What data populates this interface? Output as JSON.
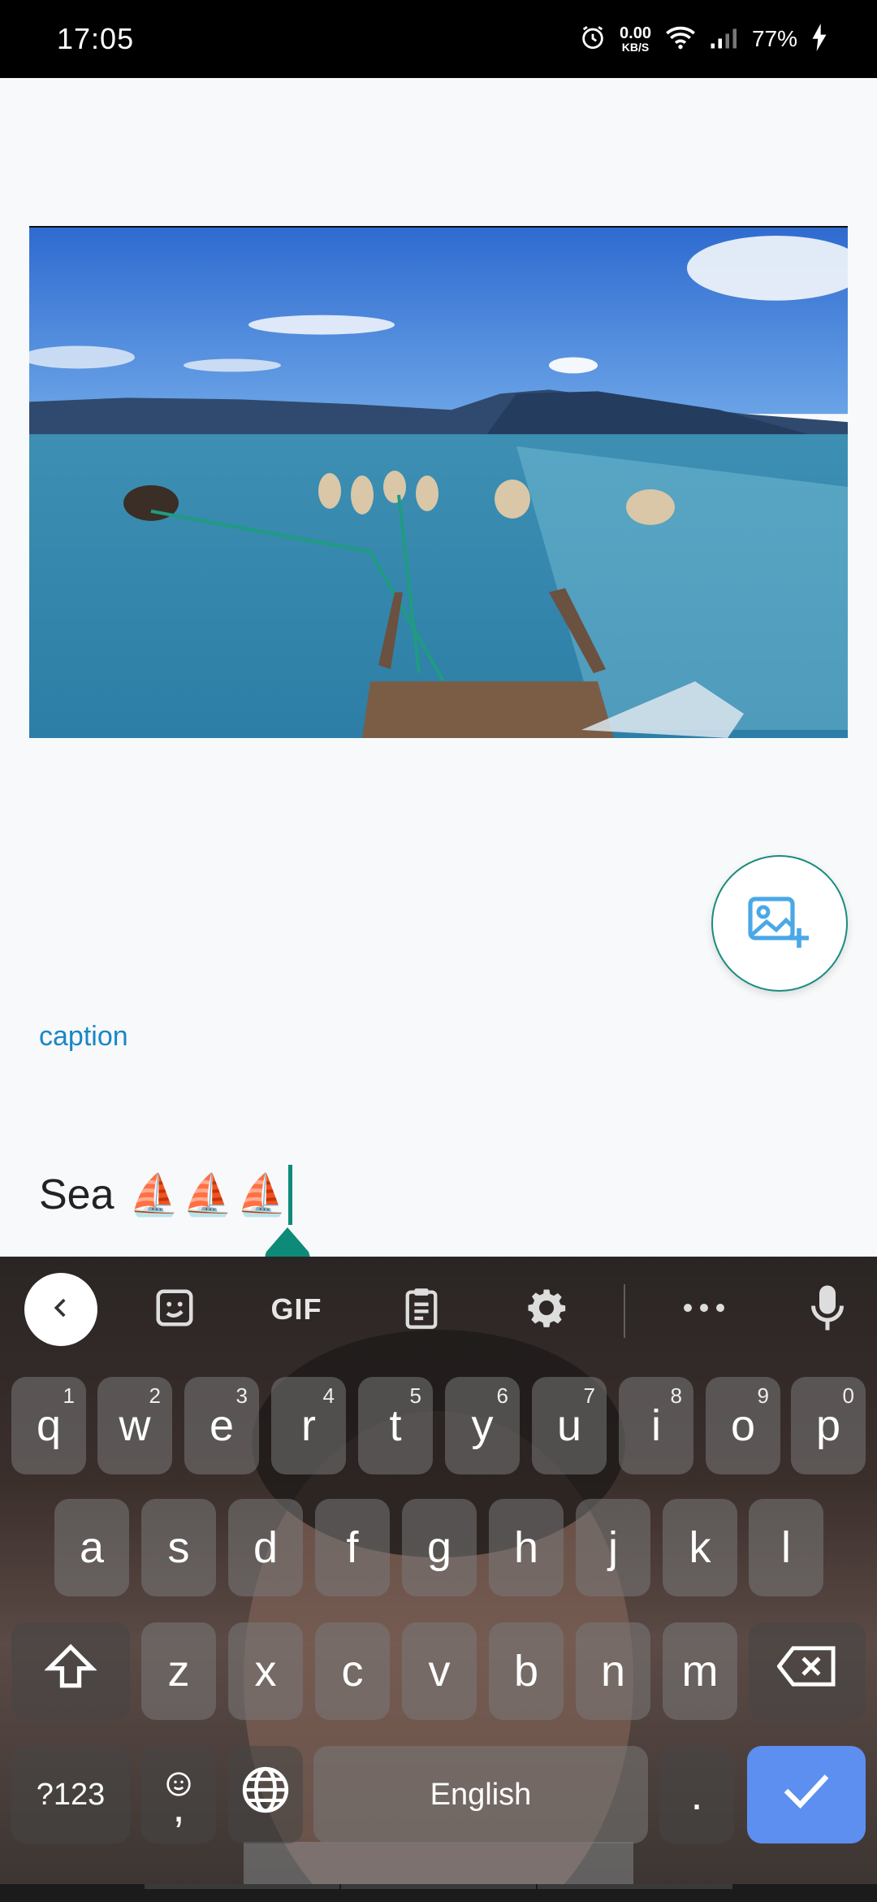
{
  "status_bar": {
    "time": "17:05",
    "net_speed_value": "0.00",
    "net_speed_unit": "KB/S",
    "battery": "77%"
  },
  "photo": {
    "description_icon": "photo-preview"
  },
  "add_photo": {
    "icon": "add-photo-icon",
    "accent": "#1b8c7e",
    "icon_color": "#4aa8e6"
  },
  "caption": {
    "label": "caption",
    "text": "Sea",
    "emojis": [
      "⛵",
      "⛵",
      "⛵"
    ]
  },
  "keyboard": {
    "toolbar": {
      "gif_label": "GIF",
      "icons": [
        "back-icon",
        "sticker-icon",
        "gif",
        "clipboard-icon",
        "gear-icon",
        "more-icon",
        "mic-icon"
      ]
    },
    "rows": [
      [
        {
          "label": "q",
          "hint": "1"
        },
        {
          "label": "w",
          "hint": "2"
        },
        {
          "label": "e",
          "hint": "3"
        },
        {
          "label": "r",
          "hint": "4"
        },
        {
          "label": "t",
          "hint": "5"
        },
        {
          "label": "y",
          "hint": "6"
        },
        {
          "label": "u",
          "hint": "7"
        },
        {
          "label": "i",
          "hint": "8"
        },
        {
          "label": "o",
          "hint": "9"
        },
        {
          "label": "p",
          "hint": "0"
        }
      ],
      [
        {
          "label": "a"
        },
        {
          "label": "s"
        },
        {
          "label": "d"
        },
        {
          "label": "f"
        },
        {
          "label": "g"
        },
        {
          "label": "h"
        },
        {
          "label": "j"
        },
        {
          "label": "k"
        },
        {
          "label": "l"
        }
      ],
      [
        {
          "label": "z"
        },
        {
          "label": "x"
        },
        {
          "label": "c"
        },
        {
          "label": "v"
        },
        {
          "label": "b"
        },
        {
          "label": "n"
        },
        {
          "label": "m"
        }
      ]
    ],
    "bottom": {
      "symbols_label": "?123",
      "comma_label": ",",
      "space_label": "English",
      "period_label": "."
    },
    "enter_color": "#5d8ff0"
  }
}
